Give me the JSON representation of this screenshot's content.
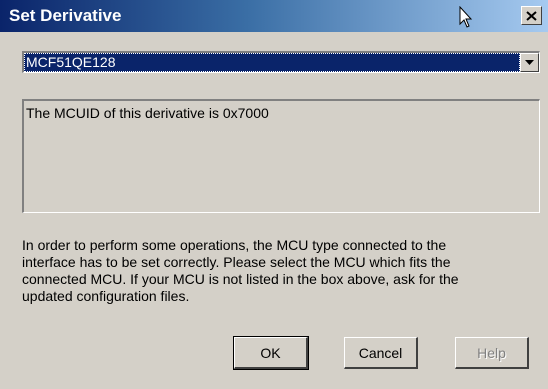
{
  "window": {
    "title": "Set Derivative",
    "close_icon": "close-icon"
  },
  "derivative_select": {
    "selected": "MCF51QE128",
    "arrow_icon": "chevron-down-icon"
  },
  "info": {
    "text": "The MCUID of this derivative is 0x7000"
  },
  "help": {
    "lines": [
      "In order to perform some operations, the MCU type connected to the",
      "interface has to be set correctly. Please select the MCU which fits the",
      "connected MCU. If your MCU is not listed in the box above, ask for the",
      "updated configuration files."
    ]
  },
  "buttons": {
    "ok": "OK",
    "cancel": "Cancel",
    "help": "Help"
  },
  "colors": {
    "titlebar_start": "#0a246a",
    "titlebar_end": "#a6caf0",
    "dialog_bg": "#d4d0c8",
    "selection_bg": "#0a246a"
  }
}
